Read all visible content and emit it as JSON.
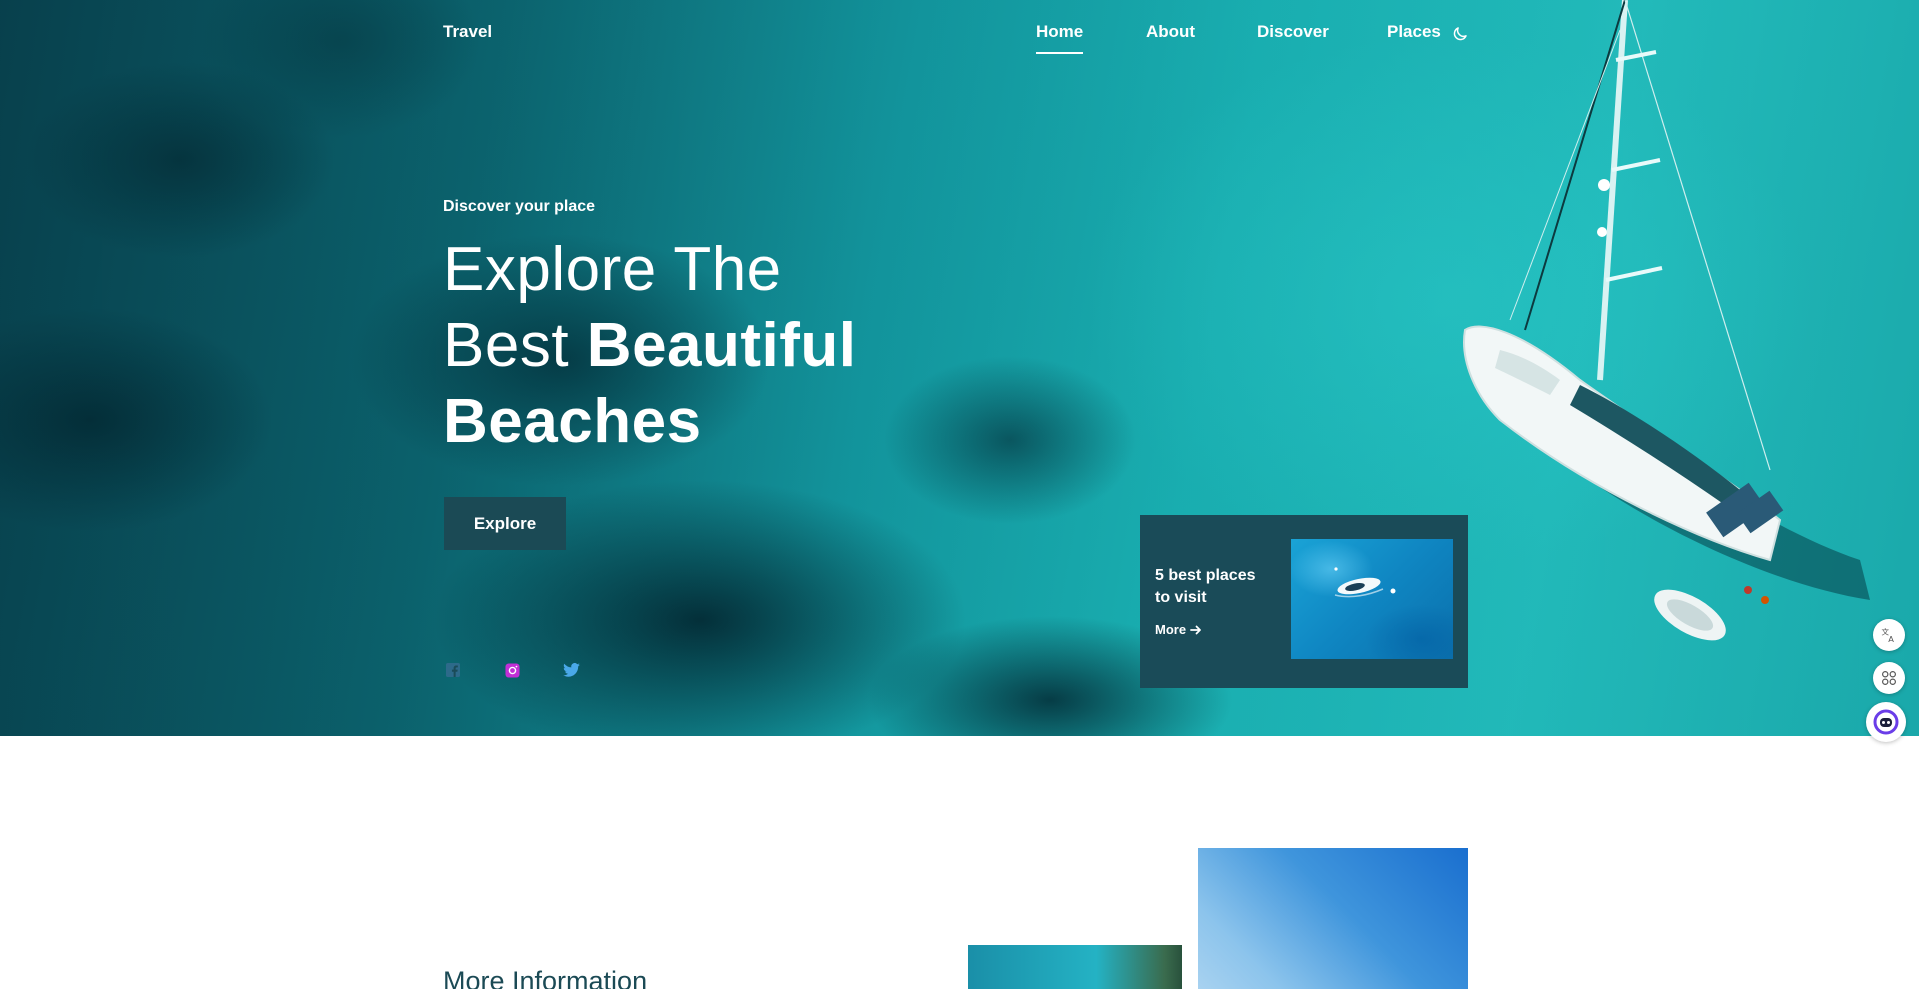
{
  "header": {
    "logo": "Travel",
    "nav": [
      {
        "label": "Home",
        "active": true
      },
      {
        "label": "About",
        "active": false
      },
      {
        "label": "Discover",
        "active": false
      },
      {
        "label": "Places",
        "active": false
      }
    ],
    "theme_icon": "moon-icon"
  },
  "hero": {
    "subtitle": "Discover your place",
    "headline_line1": "Explore The",
    "headline_line2_regular": "Best",
    "headline_line2_bold": "Beautiful",
    "headline_line3_bold": "Beaches",
    "button_label": "Explore",
    "social_icons": [
      "facebook-icon",
      "instagram-icon",
      "twitter-icon"
    ],
    "social_colors": {
      "facebook": "#2d6a8a",
      "instagram": "#c22fd6",
      "twitter": "#4aa8e8"
    }
  },
  "places_card": {
    "title": "5 best places to visit",
    "more_label": "More",
    "more_icon": "arrow-right-icon"
  },
  "side_tools": [
    "translate-icon",
    "apps-icon",
    "assistant-icon"
  ],
  "info_section": {
    "title": "More Information"
  },
  "colors": {
    "accent_dark": "#1b4a55",
    "card_bg": "#1a4b58",
    "text_light": "#ffffff"
  }
}
